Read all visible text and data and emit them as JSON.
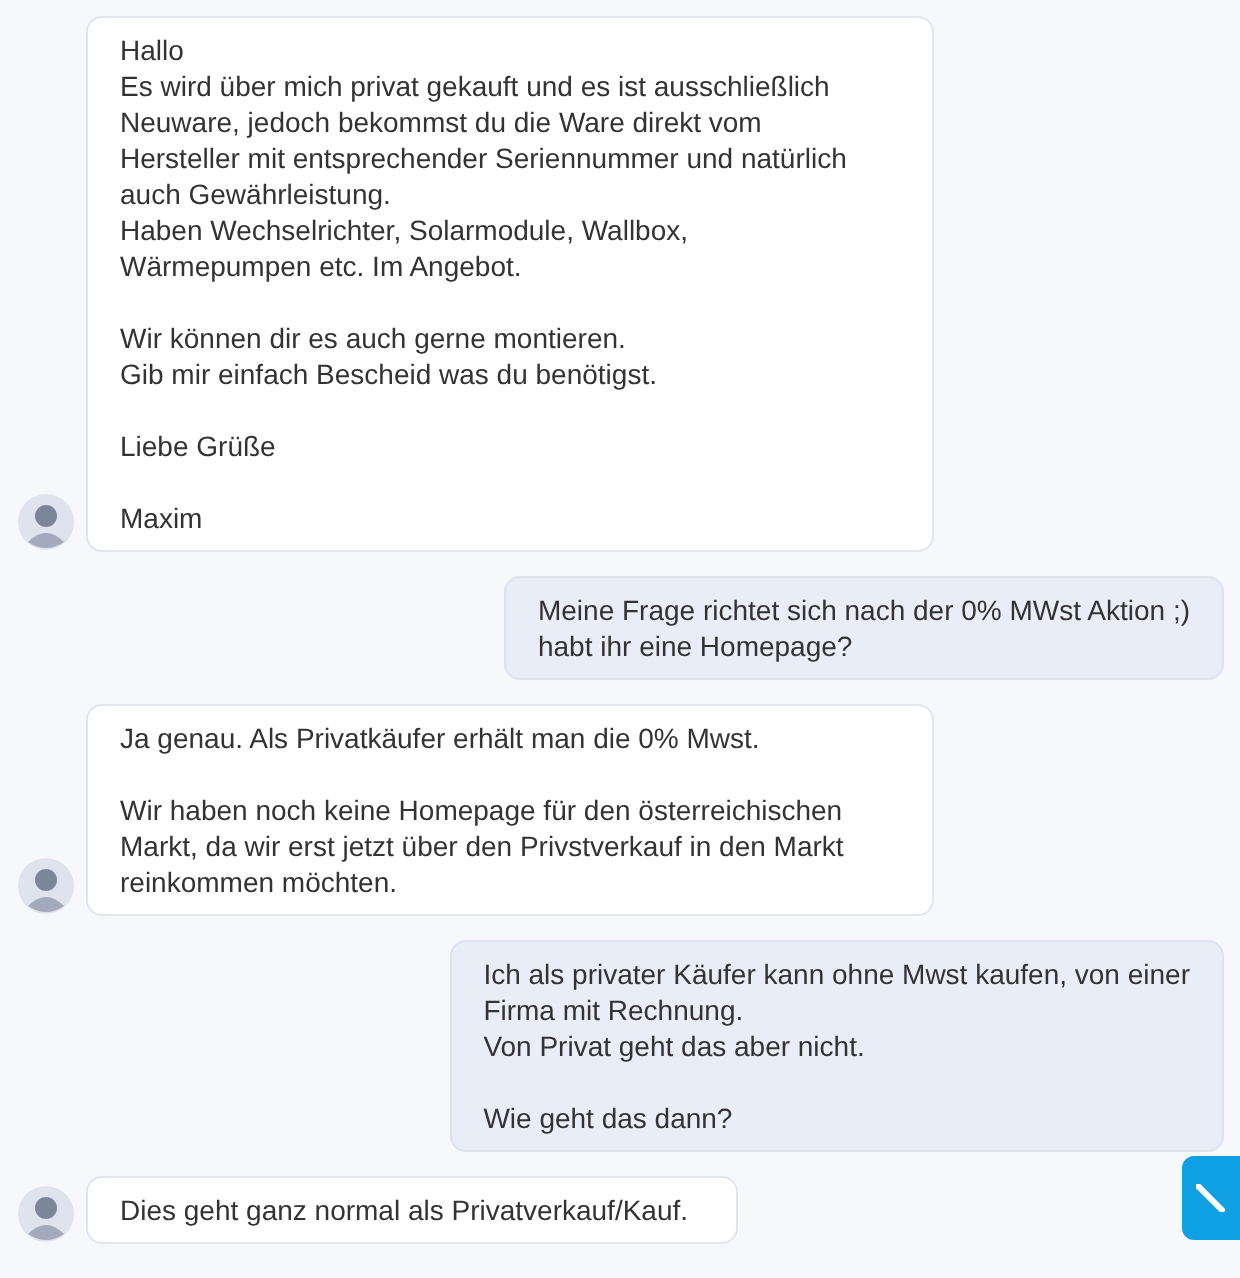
{
  "messages": [
    {
      "kind": "incoming",
      "text": "Hallo\nEs wird über mich privat gekauft und es ist ausschließlich\nNeuware, jedoch bekommst du die Ware direkt vom\nHersteller mit entsprechender Seriennummer und natürlich\nauch Gewährleistung.\nHaben Wechselrichter, Solarmodule, Wallbox,\nWärmepumpen etc. Im Angebot.\n\nWir können dir es auch gerne montieren.\nGib mir einfach Bescheid was du benötigst.\n\nLiebe Grüße\n\nMaxim"
    },
    {
      "kind": "outgoing",
      "text": "Meine Frage richtet sich nach der 0% MWst Aktion ;)\nhabt ihr eine Homepage?"
    },
    {
      "kind": "incoming",
      "text": "Ja genau. Als Privatkäufer erhält man die 0% Mwst.\n\nWir haben noch keine Homepage für den österreichischen\nMarkt, da wir erst jetzt über den Privstverkauf in den Markt\nreinkommen möchten."
    },
    {
      "kind": "outgoing",
      "text": "Ich als privater Käufer kann ohne Mwst kaufen, von einer\nFirma mit Rechnung.\nVon Privat geht das aber nicht.\n\nWie geht das dann?"
    },
    {
      "kind": "incoming",
      "text": "Dies geht ganz normal als Privatverkauf/Kauf."
    }
  ]
}
